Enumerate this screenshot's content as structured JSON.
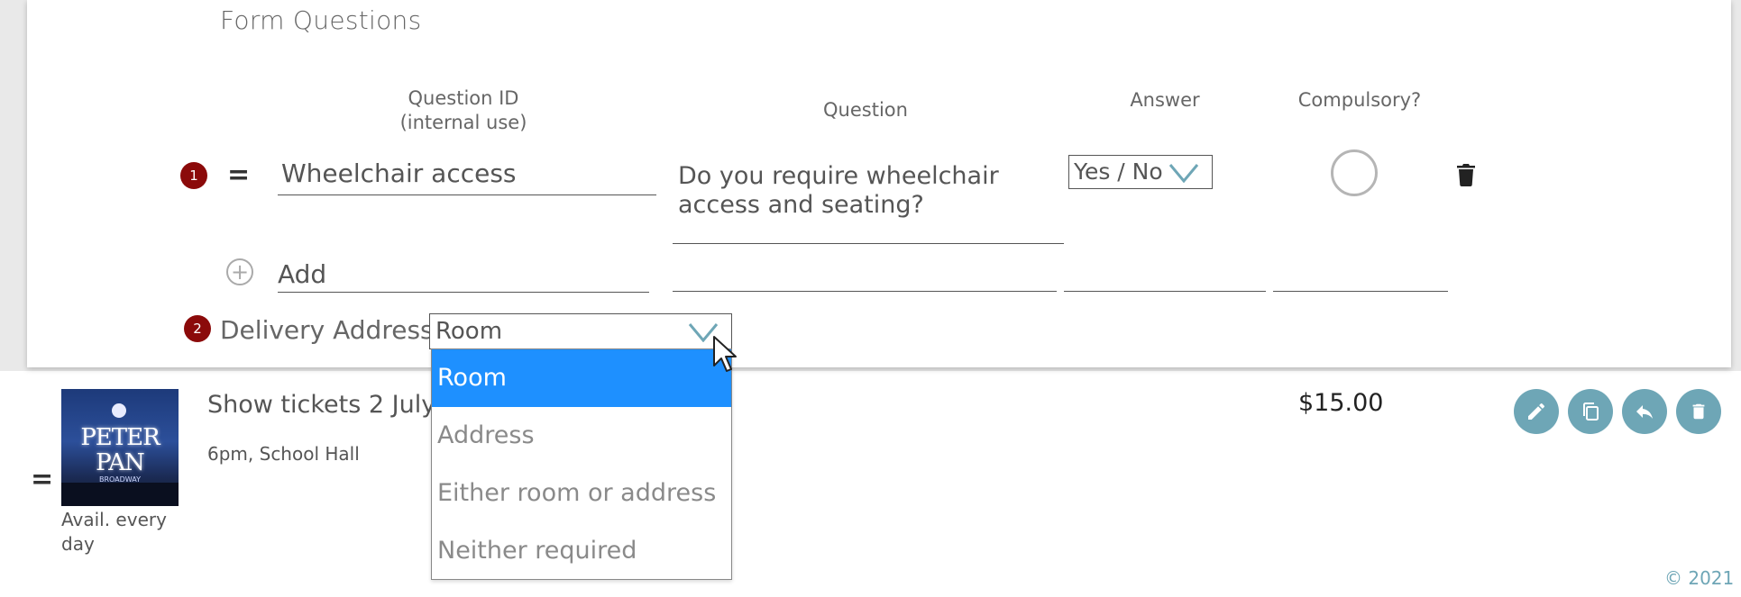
{
  "form": {
    "section_title": "Form Questions",
    "columns": {
      "question_id_line1": "Question ID",
      "question_id_line2": "(internal use)",
      "question": "Question",
      "answer": "Answer",
      "compulsory": "Compulsory?"
    },
    "rows": [
      {
        "number": "1",
        "question_id": "Wheelchair access",
        "question_line1": "Do you require wheelchair",
        "question_line2": "access and seating?",
        "answer_type": "Yes / No",
        "compulsory": false
      }
    ],
    "add_placeholder": "Add"
  },
  "delivery": {
    "number": "2",
    "label": "Delivery Address:",
    "selected": "Room",
    "options": [
      "Room",
      "Address",
      "Either room or address",
      "Neither required"
    ]
  },
  "product": {
    "title": "Show tickets 2 July",
    "subtitle": "6pm, School Hall",
    "price": "$15.00",
    "availability": "Avail. every day",
    "poster_title_line1": "PETER",
    "poster_title_line2": "PAN",
    "poster_subtitle": "BROADWAY"
  },
  "footer": {
    "copyright": "© 2021"
  },
  "colors": {
    "badge": "#8b0a0a",
    "selected_option": "#1e90ff",
    "action_button": "#6ea6b6",
    "footer_text": "#6ea6b6"
  }
}
